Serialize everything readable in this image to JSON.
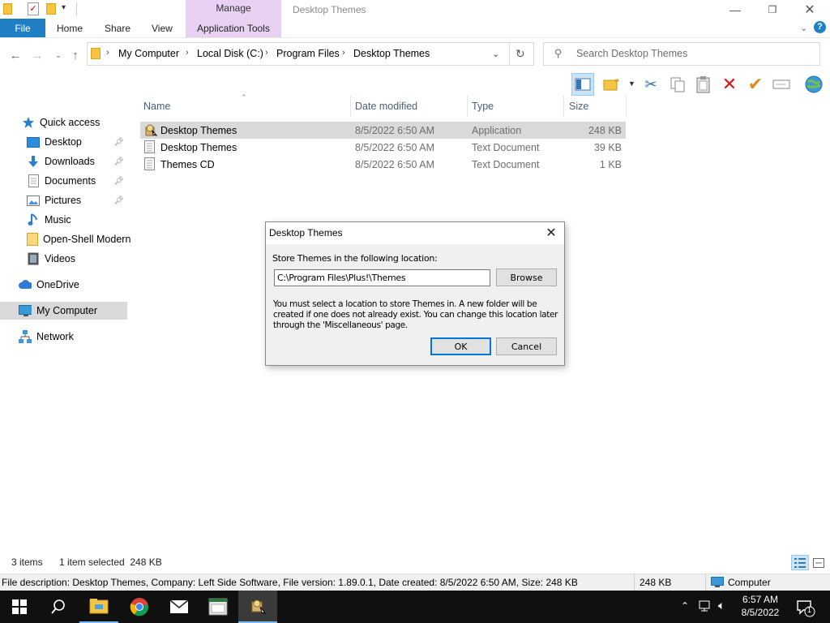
{
  "window": {
    "title": "Desktop Themes",
    "manage_label": "Manage",
    "ribbon_tabs": [
      "File",
      "Home",
      "Share",
      "View",
      "Application Tools"
    ]
  },
  "address": {
    "crumbs": [
      "My Computer",
      "Local Disk (C:)",
      "Program Files",
      "Desktop Themes"
    ],
    "search_placeholder": "Search Desktop Themes"
  },
  "nav": {
    "items": [
      {
        "label": "Quick access",
        "icon": "star-icon",
        "pinned": false
      },
      {
        "label": "Desktop",
        "icon": "desktop-icon",
        "pinned": true
      },
      {
        "label": "Downloads",
        "icon": "download-icon",
        "pinned": true
      },
      {
        "label": "Documents",
        "icon": "document-icon",
        "pinned": true
      },
      {
        "label": "Pictures",
        "icon": "pictures-icon",
        "pinned": true
      },
      {
        "label": "Music",
        "icon": "music-icon",
        "pinned": false
      },
      {
        "label": "Open-Shell Modern",
        "icon": "folder-icon",
        "pinned": false
      },
      {
        "label": "Videos",
        "icon": "video-icon",
        "pinned": false
      },
      {
        "label": "OneDrive",
        "icon": "cloud-icon",
        "pinned": false
      },
      {
        "label": "My Computer",
        "icon": "computer-icon",
        "pinned": false
      },
      {
        "label": "Network",
        "icon": "network-icon",
        "pinned": false
      }
    ]
  },
  "files": {
    "headers": {
      "name": "Name",
      "date": "Date modified",
      "type": "Type",
      "size": "Size"
    },
    "rows": [
      {
        "name": "Desktop Themes",
        "date": "8/5/2022 6:50 AM",
        "type": "Application",
        "size": "248 KB",
        "selected": true,
        "icon": "application-icon"
      },
      {
        "name": "Desktop Themes",
        "date": "8/5/2022 6:50 AM",
        "type": "Text Document",
        "size": "39 KB",
        "selected": false,
        "icon": "text-file-icon"
      },
      {
        "name": "Themes CD",
        "date": "8/5/2022 6:50 AM",
        "type": "Text Document",
        "size": "1 KB",
        "selected": false,
        "icon": "text-file-icon"
      }
    ]
  },
  "dialog": {
    "title": "Desktop Themes",
    "label": "Store Themes in the following location:",
    "path": "C:\\Program Files\\Plus!\\Themes",
    "browse": "Browse",
    "message": "You must select a location to store Themes in. A new folder will be created if one does not already exist. You can change this location later through the 'Miscellaneous' page.",
    "ok": "OK",
    "cancel": "Cancel"
  },
  "status": {
    "items": "3 items",
    "selected": "1 item selected  248 KB"
  },
  "description_bar": {
    "text": "File description: Desktop Themes, Company: Left Side Software, File version: 1.89.0.1, Date created: 8/5/2022 6:50 AM, Size: 248 KB",
    "size": "248 KB",
    "location": "Computer"
  },
  "taskbar": {
    "time": "6:57 AM",
    "date": "8/5/2022",
    "notification_count": "1"
  },
  "colors": {
    "accent": "#1f7fc4",
    "manage_tab": "#e8d1f2",
    "selected_row": "#d9d9d9",
    "taskbar": "#101010"
  }
}
